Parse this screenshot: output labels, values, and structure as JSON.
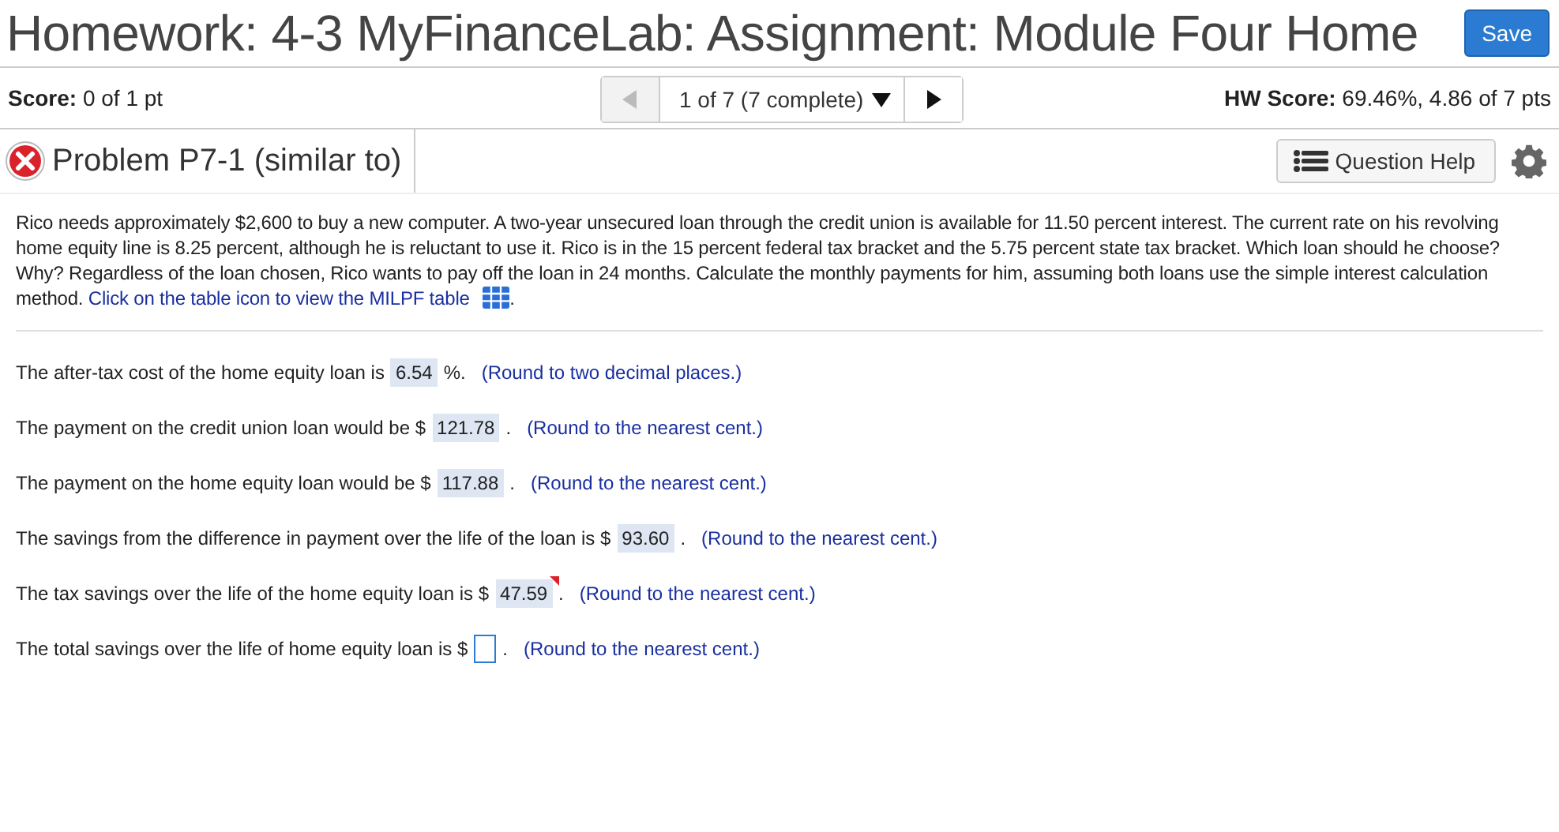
{
  "header": {
    "title": "Homework: 4-3 MyFinanceLab: Assignment: Module Four Home",
    "save_button": "Save"
  },
  "score_bar": {
    "score_label": "Score:",
    "score": "0 of 1 pt",
    "nav": {
      "position": "1 of 7 (7 complete)",
      "prev_disabled": true,
      "next_disabled": false
    },
    "hw_label": "HW Score:",
    "hw_score": "69.46%, 4.86 of 7 pts"
  },
  "problem": {
    "title": "Problem P7-1 (similar to)",
    "correct": false,
    "help_button": "Question Help"
  },
  "question": {
    "text": "Rico needs approximately $2,600 to buy a new computer. A two-year unsecured loan through the credit union is available for 11.50 percent interest. The current rate on his revolving home equity line is 8.25 percent, although he is reluctant to use it. Rico is in the 15 percent federal tax bracket and the 5.75 percent state tax bracket. Which loan should he choose? Why? Regardless of the loan chosen, Rico wants to pay off the loan in 24 months. Calculate the monthly payments for him, assuming both loans use the simple interest calculation method.",
    "link": "Click on the table icon to view the MILPF table",
    "after_link": "."
  },
  "answers": [
    {
      "prefix": "The after-tax cost of the home equity loan is",
      "answer": "6.54",
      "suffix": "%.",
      "hint": "(Round to two decimal places.)",
      "flagged": false
    },
    {
      "prefix": "The payment on the credit union loan would be $",
      "answer": "121.78",
      "suffix": ".",
      "hint": "(Round to the nearest cent.)",
      "flagged": false
    },
    {
      "prefix": "The payment on the home equity loan would be $",
      "answer": "117.88",
      "suffix": ".",
      "hint": "(Round to the nearest cent.)",
      "flagged": false
    },
    {
      "prefix": "The savings from the difference in payment over the life of the loan is $",
      "answer": "93.60",
      "suffix": ".",
      "hint": "(Round to the nearest cent.)",
      "flagged": false
    },
    {
      "prefix": "The tax savings over the life of the home equity loan is $",
      "answer": "47.59",
      "suffix": ".",
      "hint": "(Round to the nearest cent.)",
      "flagged": true
    },
    {
      "prefix": "The total savings over the life of home equity loan is $",
      "suffix": ".",
      "hint": "(Round to the nearest cent.)",
      "flagged": false
    }
  ]
}
